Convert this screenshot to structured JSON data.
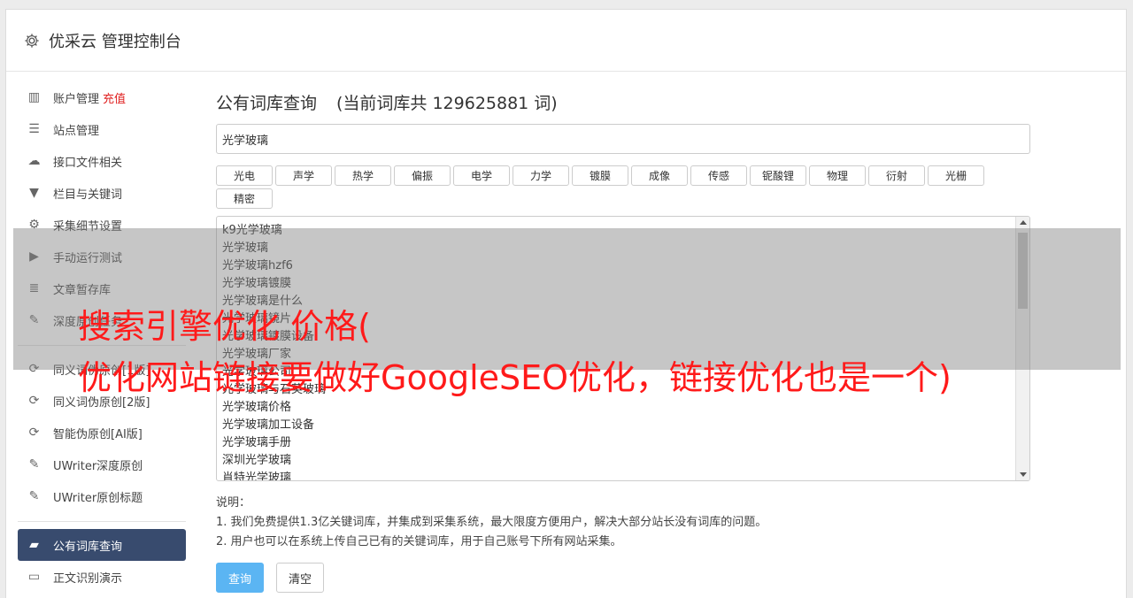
{
  "header": {
    "title": "优采云 管理控制台",
    "icon": "gear-icon"
  },
  "sidebar": {
    "items": [
      {
        "label": "账户管理",
        "badge": "充值",
        "icon": "bar-chart-icon",
        "glyph": "▥"
      },
      {
        "label": "站点管理",
        "icon": "server-icon",
        "glyph": "☰"
      },
      {
        "label": "接口文件相关",
        "icon": "cloud-upload-icon",
        "glyph": "☁"
      },
      {
        "label": "栏目与关键词",
        "icon": "filter-icon",
        "glyph": "▼"
      },
      {
        "label": "采集细节设置",
        "icon": "cogs-icon",
        "glyph": "⚙"
      },
      {
        "label": "手动运行测试",
        "icon": "play-circle-icon",
        "glyph": "▶"
      },
      {
        "label": "文章暂存库",
        "icon": "database-icon",
        "glyph": "≣"
      },
      {
        "label": "深度原创任务",
        "icon": "edit-icon",
        "glyph": "✎"
      },
      {
        "label": "同义词伪原创[1版]",
        "icon": "refresh-icon",
        "glyph": "⟳"
      },
      {
        "label": "同义词伪原创[2版]",
        "icon": "refresh-icon",
        "glyph": "⟳"
      },
      {
        "label": "智能伪原创[AI版]",
        "icon": "refresh-icon",
        "glyph": "⟳"
      },
      {
        "label": "UWriter深度原创",
        "icon": "edit-icon",
        "glyph": "✎"
      },
      {
        "label": "UWriter原创标题",
        "icon": "edit-icon",
        "glyph": "✎"
      },
      {
        "label": "公有词库查询",
        "icon": "book-icon",
        "glyph": "▰",
        "active": true
      },
      {
        "label": "正文识别演示",
        "icon": "monitor-icon",
        "glyph": "▭"
      }
    ]
  },
  "main": {
    "heading": "公有词库查询",
    "count_text": "(当前词库共 129625881 词)",
    "search_value": "光学玻璃",
    "tags": [
      "光电",
      "声学",
      "热学",
      "偏振",
      "电学",
      "力学",
      "镀膜",
      "成像",
      "传感",
      "铌酸锂",
      "物理",
      "衍射",
      "光栅",
      "精密"
    ],
    "results": [
      "k9光学玻璃",
      "光学玻璃",
      "光学玻璃hzf6",
      "光学玻璃镀膜",
      "光学玻璃是什么",
      "光学玻璃镜片",
      "光学玻璃镀膜设备",
      "光学玻璃厂家",
      "光学玻璃公司",
      "光学玻璃与石英玻璃",
      "光学玻璃价格",
      "光学玻璃加工设备",
      "光学玻璃手册",
      "深圳光学玻璃",
      "肖特光学玻璃"
    ],
    "notes_title": "说明：",
    "notes": [
      "1. 我们免费提供1.3亿关键词库，并集成到采集系统，最大限度方便用户，解决大部分站长没有词库的问题。",
      "2. 用户也可以在系统上传自己已有的关键词库，用于自己账号下所有网站采集。"
    ],
    "query_button": "查询",
    "clear_button": "清空"
  },
  "overlay": {
    "line1": "搜索引擎优化 价格(",
    "line2": "优化网站链接要做好GoogleSEO优化，链接优化也是一个)"
  },
  "colors": {
    "active_bg": "#384b6e",
    "primary_button": "#5bb5f3",
    "badge": "#e02020",
    "overlay_text": "#ff1a1a"
  }
}
